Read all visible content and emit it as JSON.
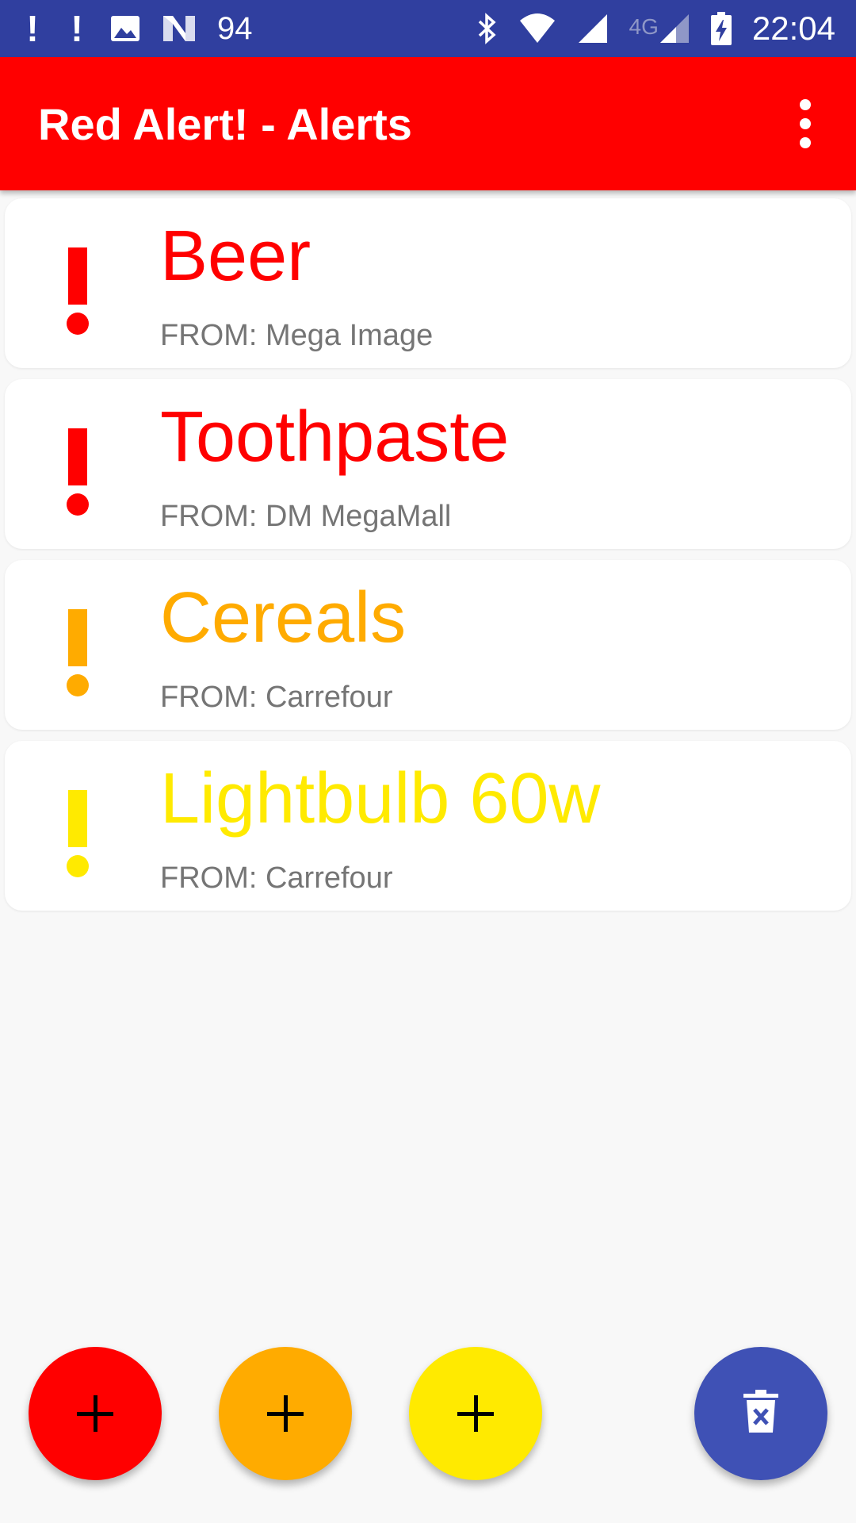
{
  "status_bar": {
    "battery_level_text": "94",
    "network_label": "4G",
    "time": "22:04",
    "icons": [
      "notification-exclamation-icon",
      "notification-exclamation-icon",
      "image-icon",
      "nfc-n-icon",
      "bluetooth-icon",
      "wifi-icon",
      "signal-icon",
      "signal-icon",
      "battery-charging-icon"
    ]
  },
  "app_bar": {
    "title": "Red Alert! - Alerts",
    "menu_icon": "more-vert-icon",
    "color": "#ff0000"
  },
  "alerts": [
    {
      "title": "Beer",
      "from": "FROM: Mega Image",
      "color": "#ff0000"
    },
    {
      "title": "Toothpaste",
      "from": "FROM: DM MegaMall",
      "color": "#ff0000"
    },
    {
      "title": "Cereals",
      "from": "FROM: Carrefour",
      "color": "#ffab00"
    },
    {
      "title": "Lightbulb 60w",
      "from": "FROM: Carrefour",
      "color": "#ffea00"
    }
  ],
  "fabs": [
    {
      "icon": "add-icon",
      "color": "#ff0000"
    },
    {
      "icon": "add-icon",
      "color": "#ffab00"
    },
    {
      "icon": "add-icon",
      "color": "#ffea00"
    },
    {
      "icon": "delete-sweep-icon",
      "color": "#3f51b5"
    }
  ]
}
